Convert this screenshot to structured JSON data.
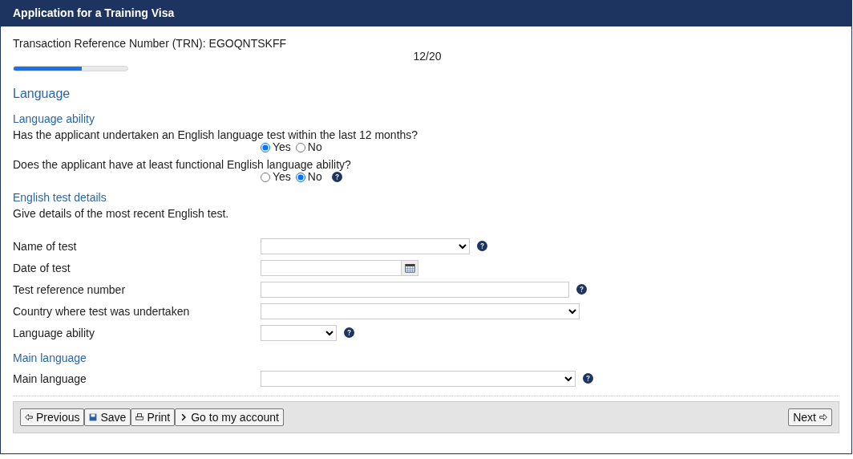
{
  "window": {
    "title": "Application for a Training Visa"
  },
  "trn": "Transaction Reference Number (TRN): EGOQNTSKFF",
  "progress": {
    "reading": "12/20",
    "level": 0.6
  },
  "section": "Language",
  "subsections": [
    {
      "heading": "Language ability",
      "questions": [
        {
          "text": "Has the applicant undertaken an English language test within the last 12 months?",
          "help": false,
          "options": [
            {
              "label": "Yes",
              "selected": true
            },
            {
              "label": "No",
              "selected": false
            }
          ]
        },
        {
          "text": "Does the applicant have at least functional English language ability?",
          "help": true,
          "options": [
            {
              "label": "Yes",
              "selected": false
            },
            {
              "label": "No",
              "selected": true
            }
          ]
        }
      ]
    },
    {
      "heading": "English test details",
      "intro": "Give details of the most recent English test.",
      "fields": [
        {
          "label": "Name of test",
          "kind": "select",
          "help": true
        },
        {
          "label": "Date of test",
          "kind": "date",
          "help": false
        },
        {
          "label": "Test reference number",
          "kind": "text",
          "help": true
        },
        {
          "label": "Country where test was undertaken",
          "kind": "select",
          "help": false
        },
        {
          "label": "Language ability",
          "kind": "select",
          "help": true
        }
      ]
    },
    {
      "heading": "Main language",
      "fields": [
        {
          "label": "Main language",
          "kind": "select",
          "help": true
        }
      ]
    }
  ],
  "buttons": [
    "Previous",
    "Save",
    "Print",
    "Go to my account"
  ],
  "next": "Next"
}
